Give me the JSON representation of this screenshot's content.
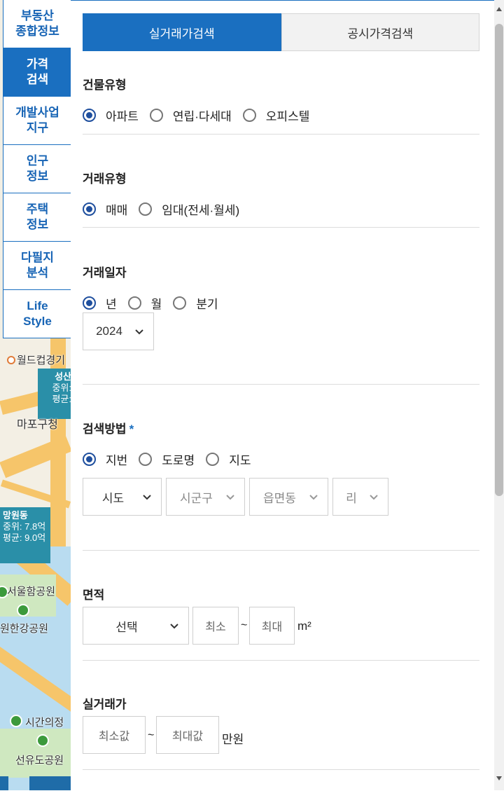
{
  "nav": {
    "items": [
      {
        "label": "부동산\n종합정보"
      },
      {
        "label": "가격\n검색"
      },
      {
        "label": "개발사업\n지구"
      },
      {
        "label": "인구\n정보"
      },
      {
        "label": "주택\n정보"
      },
      {
        "label": "다필지\n분석"
      },
      {
        "label": "Life\nStyle"
      }
    ]
  },
  "map": {
    "labels": {
      "worldcup": "월드컵경기",
      "seongsan": "성산",
      "seongsan_median": "중위:",
      "seongsan_avg": "평균:",
      "mapo": "마포구청",
      "mangwon": "망원동",
      "mangwon_median": "중위: 7.8억",
      "mangwon_avg": "평균: 9.0억",
      "seoulham": "서울함공원",
      "hangang": "원한강공원",
      "sigan": "시간의정",
      "seonyudo": "선유도공원"
    }
  },
  "tabs": {
    "trade": "실거래가검색",
    "public": "공시가격검색"
  },
  "building": {
    "title": "건물유형",
    "options": [
      "아파트",
      "연립·다세대",
      "오피스텔"
    ]
  },
  "deal": {
    "title": "거래유형",
    "options": [
      "매매",
      "임대(전세·월세)"
    ]
  },
  "date": {
    "title": "거래일자",
    "options": [
      "년",
      "월",
      "분기"
    ],
    "year": "2024"
  },
  "search": {
    "title": "검색방법",
    "required_mark": "*",
    "options": [
      "지번",
      "도로명",
      "지도"
    ],
    "sido": "시도",
    "sigungu": "시군구",
    "eupmyeondong": "읍면동",
    "ri": "리"
  },
  "area": {
    "title": "면적",
    "select": "선택",
    "min": "최소",
    "tilde": "~",
    "max": "최대",
    "unit": "m²"
  },
  "price": {
    "title": "실거래가",
    "min": "최소값",
    "tilde": "~",
    "max": "최대값",
    "unit": "만원"
  }
}
